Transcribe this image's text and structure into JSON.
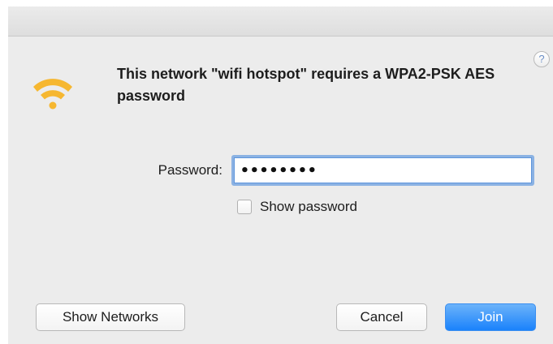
{
  "dialog": {
    "message": "This network \"wifi hotspot\" requires a WPA2-PSK AES password",
    "help_label": "?",
    "icon": "wifi-icon"
  },
  "form": {
    "password_label": "Password:",
    "password_value": "••••••••",
    "show_password_label": "Show password",
    "show_password_checked": false
  },
  "buttons": {
    "show_networks": "Show Networks",
    "cancel": "Cancel",
    "join": "Join"
  },
  "colors": {
    "wifi_icon": "#f6b730",
    "primary_button": "#2b8cfb",
    "focus_ring": "#8bb2e3"
  }
}
